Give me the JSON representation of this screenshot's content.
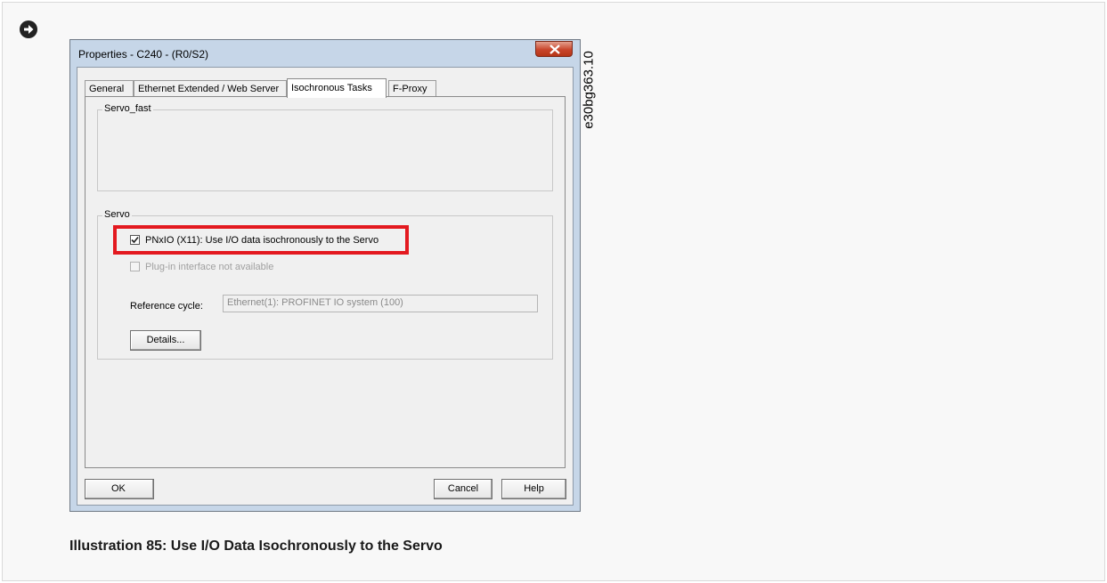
{
  "dialog": {
    "title": "Properties - C240 - (R0/S2)",
    "tabs": [
      {
        "label": "General"
      },
      {
        "label": "Ethernet Extended / Web Server"
      },
      {
        "label": "Isochronous Tasks"
      },
      {
        "label": "F-Proxy"
      }
    ],
    "active_tab": "Isochronous Tasks",
    "servo_fast_group": {
      "legend": "Servo_fast"
    },
    "servo_group": {
      "legend": "Servo",
      "pnxio_checkbox": {
        "label": "PNxIO (X11): Use I/O data isochronously to the Servo",
        "checked": true,
        "enabled": true
      },
      "plugin_checkbox": {
        "label": "Plug-in interface not available",
        "checked": false,
        "enabled": false
      },
      "reference_cycle": {
        "label": "Reference cycle:",
        "value": "Ethernet(1): PROFINET IO system (100)"
      },
      "details_button": "Details..."
    },
    "buttons": {
      "ok": "OK",
      "cancel": "Cancel",
      "help": "Help"
    }
  },
  "highlight_color": "#e3191f",
  "figure_code": "e30bg363.10",
  "caption": "Illustration 85: Use I/O Data Isochronously to the Servo",
  "icons": {
    "bullet": "arrow-circle-right-icon",
    "close": "close-icon",
    "check": "checkmark-icon"
  }
}
